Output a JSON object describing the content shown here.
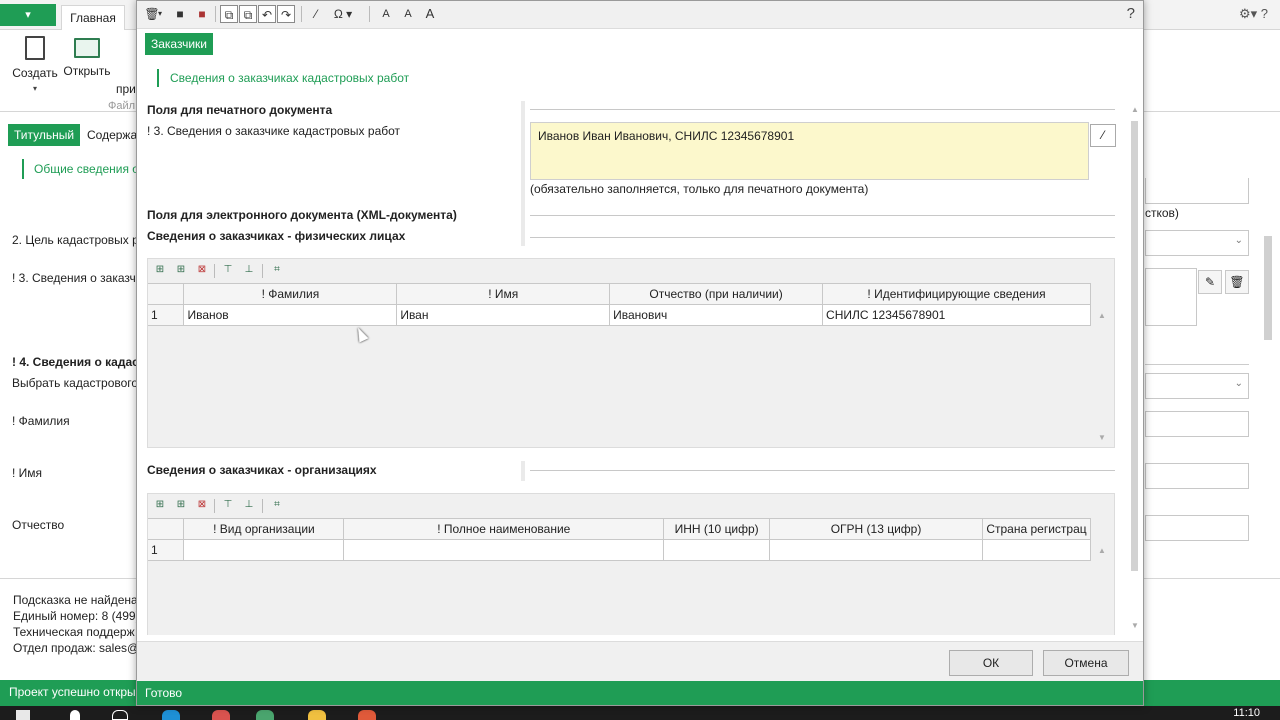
{
  "background_app": {
    "menu_button": "▾",
    "ribbon_tab_main": "Главная",
    "ribbon_buttons": [
      "Создать",
      "Открыть"
    ],
    "ribbon_cut_label": "при",
    "ribbon_group_label": "Файл",
    "top_right_icons": "⚙▾ ?",
    "tab_title": "Титульный",
    "tab_contents": "Содержа",
    "sub_section": "Общие сведения о",
    "labels": [
      "2. Цель кадастровых р",
      "! 3. Сведения о заказч",
      "! 4. Сведения о кадас",
      "Выбрать кадастрового",
      "! Фамилия",
      "! Имя",
      "Отчество"
    ],
    "right_text": "стков)",
    "info_lines": [
      "Подсказка не найдена",
      "Единый номер: 8 (499)",
      "Техническая поддерж",
      "Отдел продаж: sales@"
    ],
    "status_text": "Проект успешно откры",
    "clock": "11:10"
  },
  "dialog": {
    "help_icon": "?",
    "toolbar_icons": [
      "trash-icon",
      "save-icon",
      "save-all-icon",
      "copy-icon",
      "paste-icon",
      "undo-icon",
      "redo-icon",
      "wand-icon",
      "omega-icon",
      "font-decrease-icon",
      "font-reset-icon",
      "font-increase-icon"
    ],
    "tab_label": "Заказчики",
    "subtitle": "Сведения о заказчиках кадастровых работ",
    "print_section": {
      "heading": "Поля для печатного документа",
      "field_label": "! 3. Сведения о заказчике кадастровых работ",
      "field_value": "Иванов Иван Иванович, СНИЛС 12345678901",
      "hint": "(обязательно заполняется, только для печатного документа)"
    },
    "xml_section": {
      "heading": "Поля для электронного документа (XML-документа)",
      "individuals_heading": "Сведения о заказчиках - физических лицах",
      "organizations_heading": "Сведения о заказчиках - организациях"
    },
    "individuals_grid": {
      "columns": [
        "! Фамилия",
        "! Имя",
        "Отчество (при наличии)",
        "! Идентифицирующие сведения"
      ],
      "rows": [
        {
          "n": "1",
          "cells": [
            "Иванов",
            "Иван",
            "Иванович",
            "СНИЛС 12345678901"
          ]
        }
      ]
    },
    "organizations_grid": {
      "columns": [
        "! Вид организации",
        "! Полное наименование",
        "ИНН (10 цифр)",
        "ОГРН (13 цифр)",
        "Страна регистрац"
      ],
      "rows": [
        {
          "n": "1",
          "cells": [
            "",
            "",
            "",
            "",
            ""
          ]
        }
      ]
    },
    "buttons": {
      "ok": "ОК",
      "cancel": "Отмена"
    },
    "status": "Готово"
  }
}
